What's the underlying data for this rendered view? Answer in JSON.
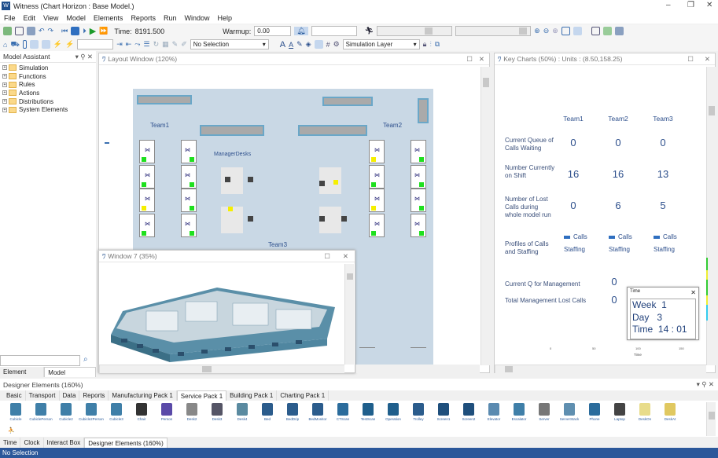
{
  "app": {
    "title": "Witness (Chart Horizon : Base Model.)"
  },
  "menu": [
    "File",
    "Edit",
    "View",
    "Model",
    "Elements",
    "Reports",
    "Run",
    "Window",
    "Help"
  ],
  "toolbar": {
    "time_label": "Time:",
    "time_value": "8191.500",
    "warmup_label": "Warmup:",
    "warmup_value": "0.00",
    "selection": "No Selection",
    "layer": "Simulation Layer"
  },
  "model_assistant": {
    "title": "Model Assistant",
    "items": [
      "Simulation",
      "Functions",
      "Rules",
      "Actions",
      "Distributions",
      "System Elements"
    ],
    "tabs": [
      "Element Tree",
      "Model Assistant"
    ]
  },
  "layout_window": {
    "title": "Layout Window (120%)",
    "labels": {
      "team1": "Team1",
      "team2": "Team2",
      "team3": "Team3",
      "managers": "ManagerDesks"
    }
  },
  "window7": {
    "title": "Window 7 (35%)"
  },
  "key_charts": {
    "title": "Key Charts (50%)  : Units : (8.50,158.25)",
    "teams": [
      "Team1",
      "Team2",
      "Team3"
    ],
    "rows": [
      {
        "label": "Current Queue of Calls Waiting",
        "values": [
          "0",
          "0",
          "0"
        ]
      },
      {
        "label": "Number Currently on Shift",
        "values": [
          "16",
          "16",
          "13"
        ]
      },
      {
        "label": "Number of Lost Calls during whole model run",
        "values": [
          "0",
          "6",
          "5"
        ]
      }
    ],
    "profiles_label": "Profiles of Calls and Staffing",
    "legend_calls": "Calls",
    "legend_staffing": "Staffing",
    "mgmt_q_label": "Current Q for Management",
    "mgmt_q_value": "0",
    "mgmt_lost_label": "Total Management Lost Calls",
    "mgmt_lost_value": "0",
    "axis_ticks": [
      "0",
      "50",
      "100",
      "150"
    ],
    "axis_label": "Time"
  },
  "time_box": {
    "title": "Time",
    "week_label": "Week",
    "week": "1",
    "day_label": "Day",
    "day": "3",
    "time_label": "Time",
    "time": "14 : 01"
  },
  "designer": {
    "title": "Designer Elements (160%)",
    "tabs": [
      "Basic",
      "Transport",
      "Data",
      "Reports",
      "Manufacturing Pack 1",
      "Service Pack 1",
      "Building Pack 1",
      "Charting Pack 1"
    ],
    "selected_tab": "Service Pack 1",
    "items": [
      "Cubicle",
      "CubiclePerson",
      "Cubicle2",
      "Cubicle2Person",
      "Cubicle3",
      "Chair",
      "Person",
      "Desk2",
      "Desk3",
      "Desk4",
      "Bed",
      "BedDrip",
      "BedMonitor",
      "CTScan",
      "TestScan",
      "Operation",
      "Trolley",
      "Screen1",
      "Screen2",
      "Elevator",
      "Escalator",
      "Server",
      "ServerStack",
      "Phone",
      "Laptop",
      "DeskOn",
      "DeskAt"
    ]
  },
  "bottom_tabs": [
    "Time",
    "Clock",
    "Interact Box",
    "Designer Elements (160%)"
  ],
  "status": {
    "text": "No Selection",
    "color": "#2b579a"
  }
}
